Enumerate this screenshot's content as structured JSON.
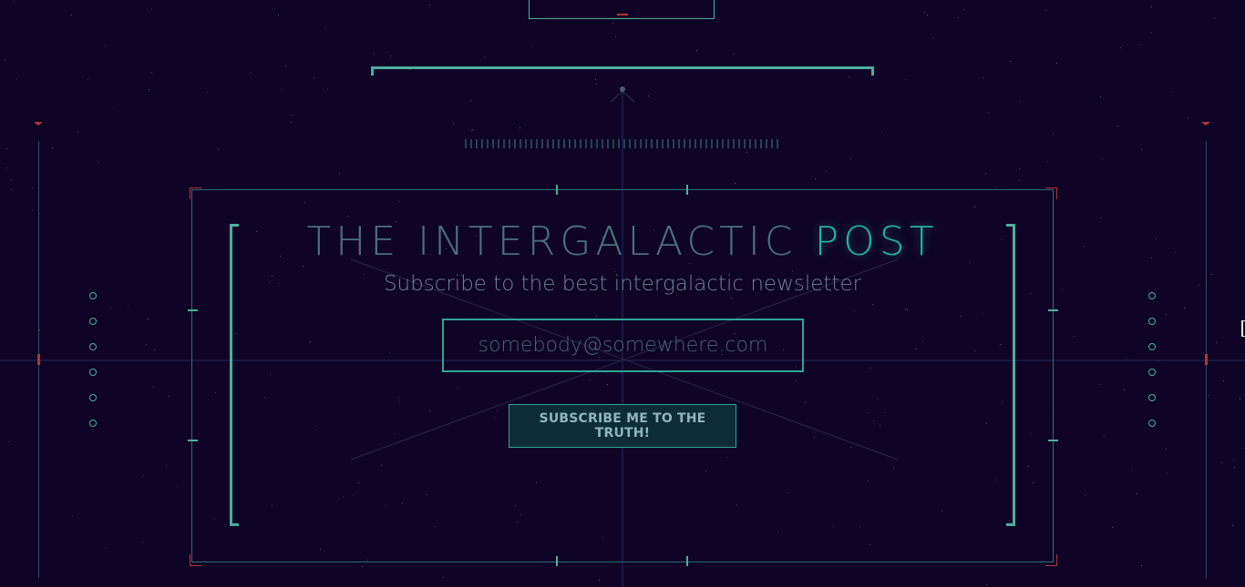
{
  "newsletter": {
    "title_main": "THE INTERGALACTIC ",
    "title_accent": "POST",
    "subtitle": "Subscribe to the best intergalactic newsletter",
    "email_placeholder": "somebody@somewhere.com",
    "email_value": "",
    "subscribe_label": "SUBSCRIBE ME TO THE TRUTH!"
  },
  "colors": {
    "background": "#0f0425",
    "accent": "#1fb3a6",
    "frame_line": "#4fae9e",
    "alert_red": "#b0353f"
  }
}
